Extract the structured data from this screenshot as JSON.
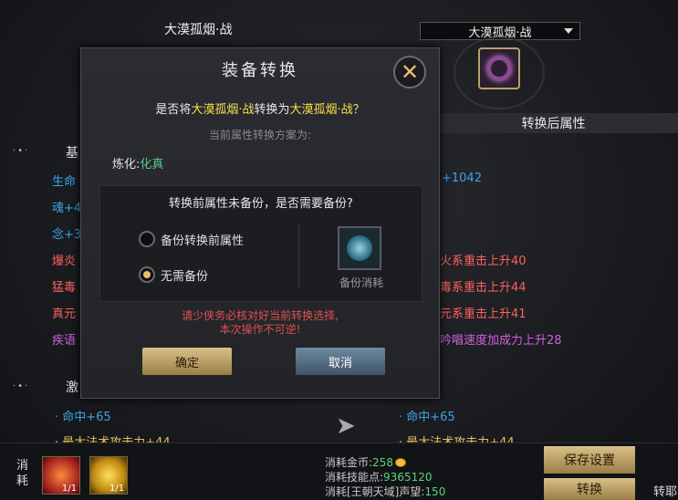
{
  "header": {
    "left_name": "大漠孤烟·战",
    "dropdown_value": "大漠孤烟·战"
  },
  "columns": {
    "right_header": "转换后属性"
  },
  "left_panel": {
    "section1_prefix": "基",
    "stats": [
      {
        "text": "生命",
        "color": "blue"
      },
      {
        "text": "魂+4",
        "color": "blue"
      },
      {
        "text": "念+3",
        "color": "blue"
      },
      {
        "text": "爆炎",
        "color": "red"
      },
      {
        "text": "猛毒",
        "color": "red"
      },
      {
        "text": "真元",
        "color": "red"
      },
      {
        "text": "疾语",
        "color": "purple"
      }
    ],
    "section2_prefix": "激",
    "bottom_stats": [
      "· 命中+65",
      "· 最大法术攻击力+44"
    ]
  },
  "right_panel": {
    "stats": [
      {
        "text": "+1042",
        "color": "blue"
      },
      {
        "text": "火系重击上升40",
        "color": "red"
      },
      {
        "text": "毒系重击上升44",
        "color": "red"
      },
      {
        "text": "元系重击上升41",
        "color": "red"
      },
      {
        "text": "吟唱速度加成力上升28",
        "color": "purple"
      }
    ],
    "bottom_stats": [
      "· 命中+65",
      "· 最大法术攻击力+44"
    ]
  },
  "dialog": {
    "title": "装备转换",
    "question_prefix": "是否将",
    "question_from": "大漠孤烟·战",
    "question_mid": "转换为",
    "question_to": "大漠孤烟·战",
    "question_suffix": "？",
    "subtitle": "当前属性转换方案为:",
    "refine_label": "炼化:",
    "refine_value": "化真",
    "backup_question": "转换前属性未备份，是否需要备份?",
    "option_backup": "备份转换前属性",
    "option_no_backup": "无需备份",
    "selected_option": "无需备份",
    "backup_cost_label": "备份消耗",
    "warning_line1": "请少侠务必核对好当前转换选择,",
    "warning_line2": "本次操作不可逆!",
    "confirm_label": "确定",
    "cancel_label": "取消"
  },
  "bottom_bar": {
    "consume_label": "消耗",
    "item1_count": "1/1",
    "item2_count": "1/1",
    "gold_label": "消耗金币:",
    "gold_value": "258",
    "skill_label": "消耗技能点:",
    "skill_value": "9365120",
    "rep_label": "消耗[王朝天域]声望:",
    "rep_value": "150",
    "save_label": "保存设置",
    "convert_label": "转换",
    "side_label": "转耶"
  },
  "colors": {
    "accent_gold": "#d8c088",
    "highlight_yellow": "#f5e04a",
    "warning_red": "#e05050",
    "stat_blue": "#3aa4e6",
    "stat_red": "#ff6060",
    "stat_purple": "#d060e0",
    "value_green": "#5bd57a"
  }
}
